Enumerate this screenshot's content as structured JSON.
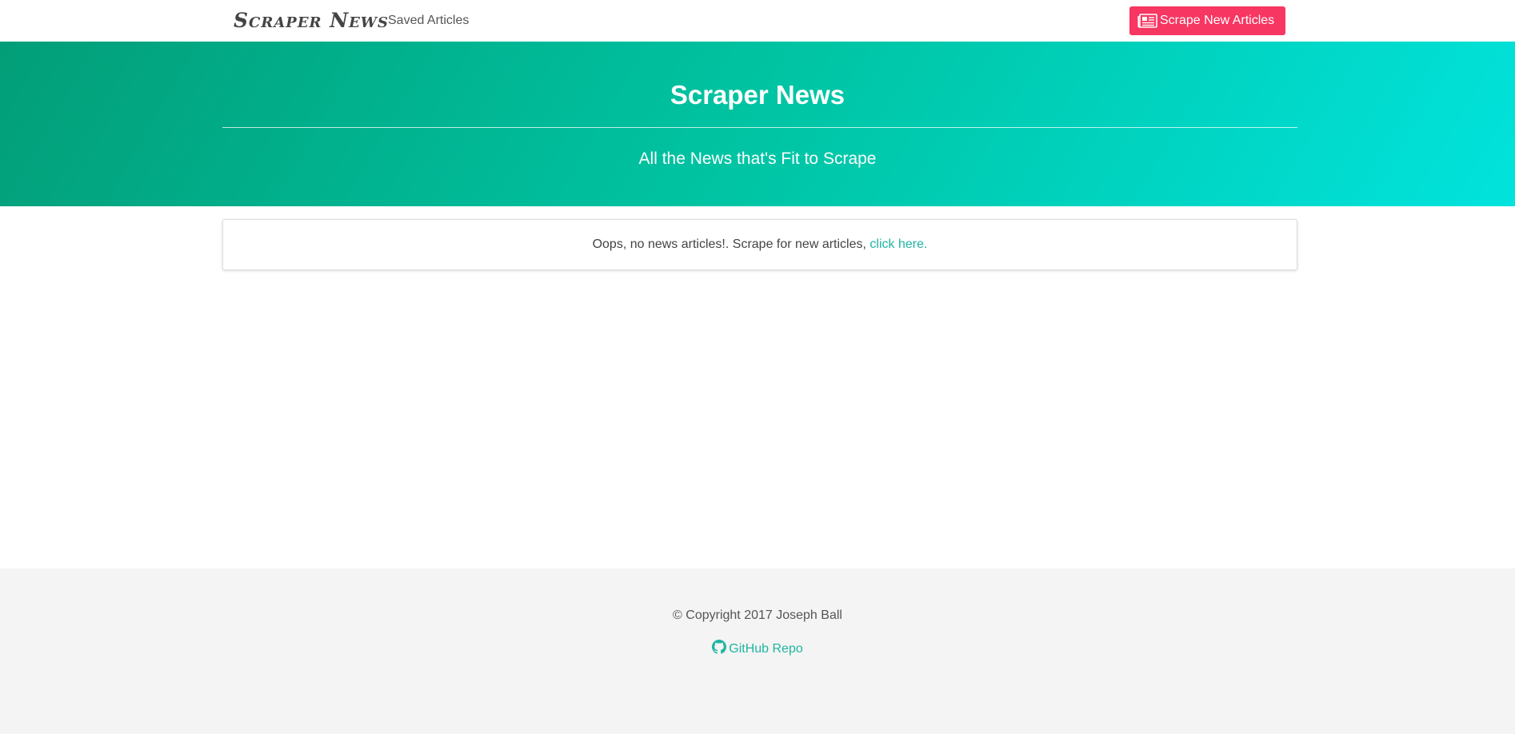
{
  "navbar": {
    "brand": "Scraper News",
    "saved_articles_label": "Saved Articles",
    "scrape_button_label": "Scrape New Articles",
    "scrape_button_icon": "newspaper-icon"
  },
  "hero": {
    "title": "Scraper News",
    "subtitle": "All the News that's Fit to Scrape"
  },
  "notice": {
    "message": "Oops, no news articles!. Scrape for new articles, ",
    "link_label": "click here."
  },
  "footer": {
    "copyright": "© Copyright 2017 Joseph Ball",
    "repo_link_label": "GitHub Repo",
    "repo_icon": "github-icon"
  },
  "colors": {
    "accent_button": "#f73662",
    "link": "#1fb5a0",
    "hero_gradient_start": "#029e78",
    "hero_gradient_end": "#01e3dd",
    "footer_bg": "#f4f4f4"
  }
}
